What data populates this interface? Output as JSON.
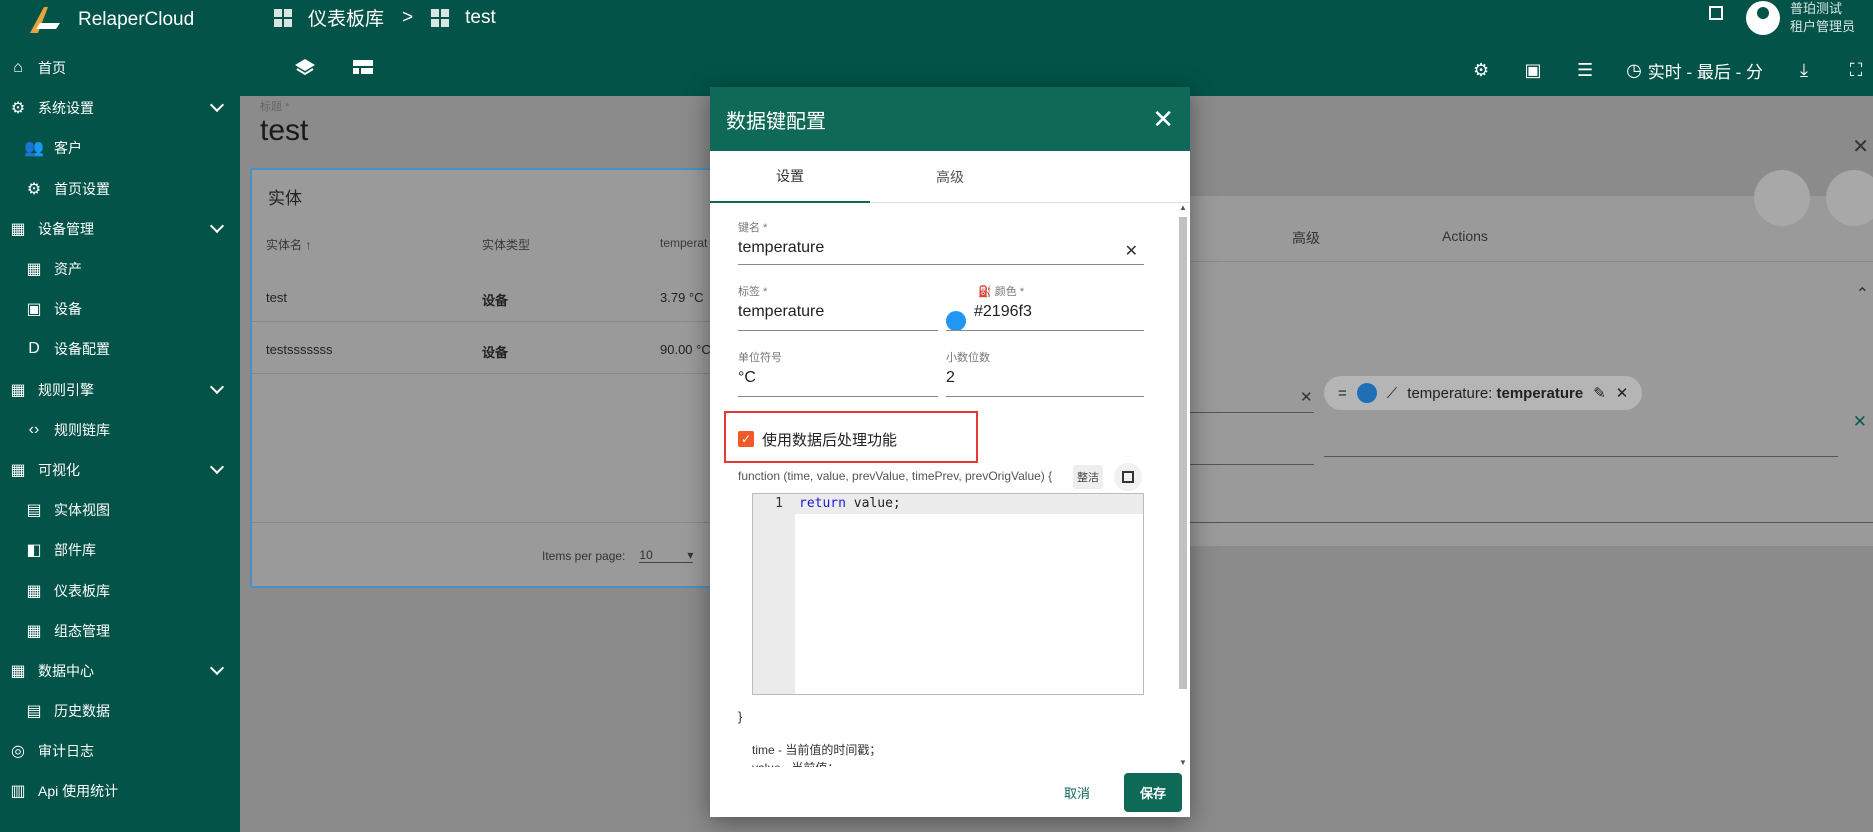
{
  "app": {
    "name": "RelaperCloud"
  },
  "sidebar": {
    "items": [
      {
        "label": "首页",
        "icon": "home-icon",
        "level": "top"
      },
      {
        "label": "系统设置",
        "icon": "gear-icon",
        "level": "top",
        "expandable": true
      },
      {
        "label": "客户",
        "icon": "people-icon",
        "level": "sub"
      },
      {
        "label": "首页设置",
        "icon": "settings-box-icon",
        "level": "sub"
      },
      {
        "label": "设备管理",
        "icon": "building-icon",
        "level": "top",
        "expandable": true
      },
      {
        "label": "资产",
        "icon": "building-icon",
        "level": "sub"
      },
      {
        "label": "设备",
        "icon": "device-icon",
        "level": "sub"
      },
      {
        "label": "设备配置",
        "icon": "device-profile-icon",
        "level": "sub"
      },
      {
        "label": "规则引擎",
        "icon": "building-icon",
        "level": "top",
        "expandable": true
      },
      {
        "label": "规则链库",
        "icon": "code-icon",
        "level": "sub"
      },
      {
        "label": "可视化",
        "icon": "building-icon",
        "level": "top",
        "expandable": true
      },
      {
        "label": "实体视图",
        "icon": "view-icon",
        "level": "sub"
      },
      {
        "label": "部件库",
        "icon": "widgets-icon",
        "level": "sub"
      },
      {
        "label": "仪表板库",
        "icon": "dashboard-icon",
        "level": "sub"
      },
      {
        "label": "组态管理",
        "icon": "dashboard-icon",
        "level": "sub"
      },
      {
        "label": "数据中心",
        "icon": "building-icon",
        "level": "top",
        "expandable": true
      },
      {
        "label": "历史数据",
        "icon": "view-icon",
        "level": "sub"
      },
      {
        "label": "审计日志",
        "icon": "track-icon",
        "level": "top"
      },
      {
        "label": "Api 使用统计",
        "icon": "bar-chart-icon",
        "level": "top"
      }
    ]
  },
  "header": {
    "breadcrumb": [
      "仪表板库",
      ">",
      "test"
    ],
    "user_name": "普珀测试",
    "user_role": "租户管理员",
    "timewindow": "实时 - 最后 - 分"
  },
  "dashboard": {
    "title_label": "标题 *",
    "title": "test",
    "entity_widget": {
      "title": "实体",
      "columns": [
        "实体名 ↑",
        "实体类型",
        "temperat"
      ],
      "rows": [
        [
          "test",
          "设备",
          "3.79 °C"
        ],
        [
          "testsssssss",
          "设备",
          "90.00 °C"
        ]
      ],
      "items_per_page_label": "Items per page:",
      "items_per_page": "10"
    }
  },
  "background_dialog": {
    "tabs": [
      "高级",
      "Actions"
    ],
    "chip_label": "temperature:",
    "chip_key": "temperature"
  },
  "modal": {
    "title": "数据键配置",
    "tabs": [
      "设置",
      "高级"
    ],
    "key_name_label": "键名 *",
    "key_name": "temperature",
    "label_label": "标签 *",
    "label_value": "temperature",
    "color_label": "颜色 *",
    "color_value": "#2196f3",
    "color_display": "#2196f3",
    "units_label": "单位符号",
    "units_value": "°C",
    "decimals_label": "小数位数",
    "decimals_value": "2",
    "postprocess_checkbox": "使用数据后处理功能",
    "postprocess_checked": true,
    "function_signature": "function (time, value, prevValue, timePrev, prevOrigValue) {",
    "tidy_label": "整洁",
    "code_line_number": "1",
    "code_keyword": "return",
    "code_rest": " value;",
    "closing_brace": "}",
    "help_line1": "time - 当前值的时间戳；",
    "help_line2": "value - 当前值；",
    "cancel_label": "取消",
    "save_label": "保存"
  },
  "colors": {
    "primary": "#035348",
    "modal_header": "#0e6956",
    "highlight": "#e53935",
    "checkbox": "#f05a28"
  }
}
